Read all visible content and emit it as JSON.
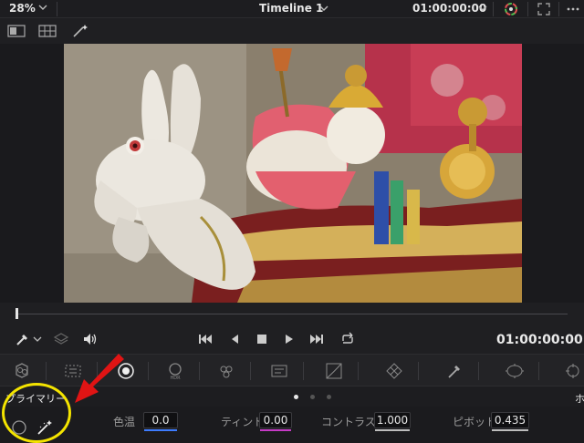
{
  "topbar": {
    "zoom": "28%",
    "timeline_title": "Timeline 1",
    "timecode": "01:00:00:00"
  },
  "transport": {
    "timecode": "01:00:00:00"
  },
  "panel": {
    "section_label": "プライマリー",
    "right_cut_label": "ホ"
  },
  "params": [
    {
      "label": "色温",
      "value": "0.0",
      "bar_color": "#3d7cff"
    },
    {
      "label": "ティント",
      "value": "0.00",
      "bar_color": "#c63ac6"
    },
    {
      "label": "コントラスト",
      "value": "1.000",
      "bar_color": "#bdbdbd"
    },
    {
      "label": "ピボット",
      "value": "0.435",
      "bar_color": "#bdbdbd"
    }
  ],
  "colors": {
    "highlight_ring": "#f4e400",
    "annotation_arrow": "#e01414"
  }
}
